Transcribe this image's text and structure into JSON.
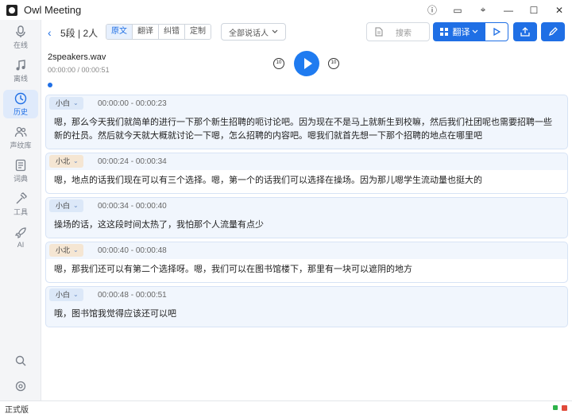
{
  "app": {
    "title": "Owl Meeting"
  },
  "window_controls": {
    "info": "ⓘ",
    "feedback": "▭",
    "pin": "⌖",
    "minimize": "—",
    "maximize": "☐",
    "close": "✕"
  },
  "sidebar": {
    "items": [
      {
        "label": "在线",
        "icon": "mic-icon",
        "glyph": "🎙"
      },
      {
        "label": "离线",
        "icon": "music-icon",
        "glyph": "♫"
      },
      {
        "label": "历史",
        "icon": "clock-icon",
        "glyph": "◷",
        "active": true
      },
      {
        "label": "声纹库",
        "icon": "users-icon",
        "glyph": "👥"
      },
      {
        "label": "词典",
        "icon": "dictionary-icon",
        "glyph": "▤"
      },
      {
        "label": "工具",
        "icon": "hammer-icon",
        "glyph": "⚒"
      },
      {
        "label": "AI",
        "icon": "rocket-icon",
        "glyph": "🚀"
      }
    ],
    "bottom": {
      "search": "⌕",
      "settings": "⚙"
    }
  },
  "toolbar": {
    "back": "‹",
    "segment_count": "5段 | 2人",
    "modes": [
      "原文",
      "翻译",
      "纠错",
      "定制"
    ],
    "active_mode": "原文",
    "speaker_filter": "全部说话人",
    "search_placeholder": "搜索",
    "translate_label": "翻译",
    "accent": "#1f6fe5"
  },
  "player": {
    "file_name": "2speakers.wav",
    "time": "00:00:00 / 00:00:51",
    "skip_back": "10",
    "skip_fwd": "10",
    "progress": 0.0
  },
  "segments": [
    {
      "speaker": "小白",
      "time": "00:00:00 - 00:00:23",
      "text": "嗯，那么今天我们就简单的进行一下那个新生招聘的呃讨论吧。因为现在不是马上就新生到校嘛，然后我们社团呢也需要招聘一些新的社员。然后就今天就大概就讨论一下嗯，怎么招聘的内容吧。嗯我们就首先想一下那个招聘的地点在哪里吧",
      "highlight": true
    },
    {
      "speaker": "小北",
      "time": "00:00:24 - 00:00:34",
      "text": "嗯，地点的话我们现在可以有三个选择。嗯，第一个的话我们可以选择在操场。因为那儿嗯学生流动量也挺大的",
      "highlight": false
    },
    {
      "speaker": "小白",
      "time": "00:00:34 - 00:00:40",
      "text": "操场的话，这这段时间太热了，我怕那个人流量有点少",
      "highlight": true
    },
    {
      "speaker": "小北",
      "time": "00:00:40 - 00:00:48",
      "text": "嗯，那我们还可以有第二个选择呀。嗯，我们可以在图书馆楼下，那里有一块可以遮阴的地方",
      "highlight": false
    },
    {
      "speaker": "小白",
      "time": "00:00:48 - 00:00:51",
      "text": "哦，图书馆我觉得应该还可以吧",
      "highlight": true
    }
  ],
  "status": {
    "label": "正式版"
  }
}
